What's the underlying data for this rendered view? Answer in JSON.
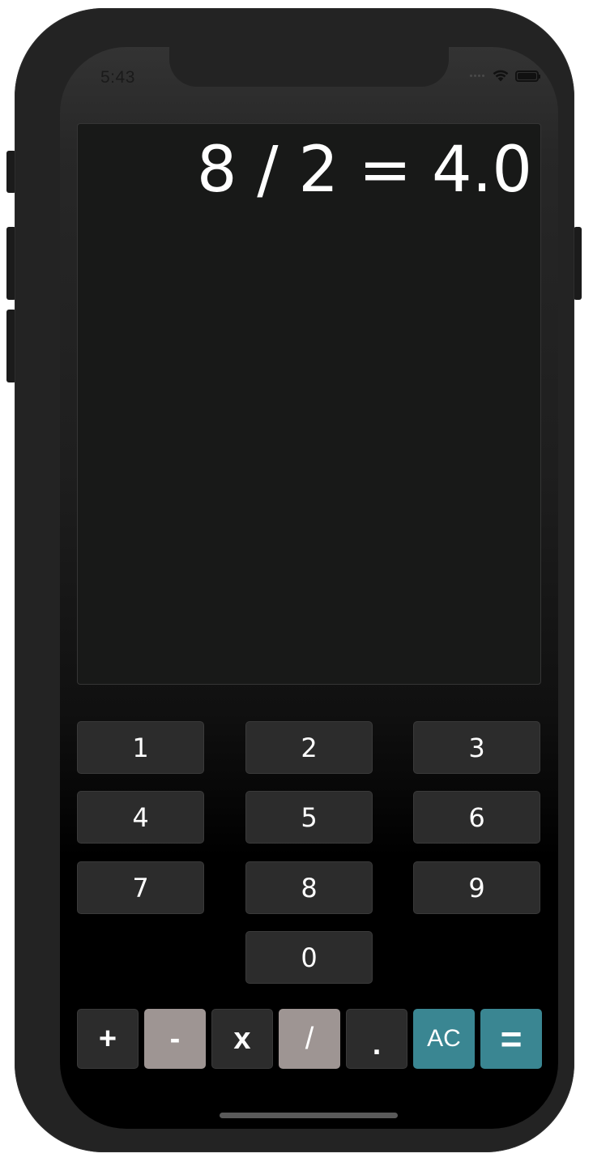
{
  "status_bar": {
    "time": "5:43",
    "icons": [
      "cellular-dots-icon",
      "wifi-icon",
      "battery-icon"
    ]
  },
  "display": {
    "expression": "8 / 2 = 4.0"
  },
  "keypad": {
    "digits": [
      "1",
      "2",
      "3",
      "4",
      "5",
      "6",
      "7",
      "8",
      "9",
      "0"
    ]
  },
  "operators": {
    "plus": "+",
    "minus": "-",
    "multiply": "x",
    "divide": "/",
    "decimal": ".",
    "clear": "AC",
    "equals": "="
  },
  "colors": {
    "display_background": "#181918",
    "key_background": "#2c2c2c",
    "operator_gray": "#9e9593",
    "accent_teal": "#3a8692"
  }
}
